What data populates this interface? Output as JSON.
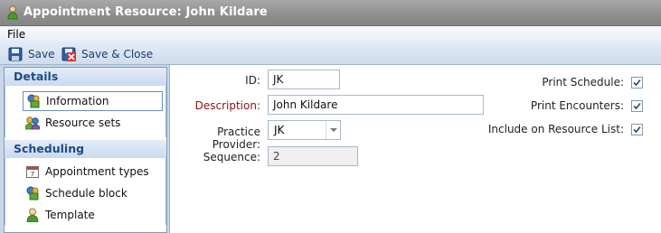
{
  "window": {
    "title": "Appointment Resource: John Kildare"
  },
  "menu": {
    "file_label": "File"
  },
  "toolbar": {
    "save_label": "Save",
    "save_close_label": "Save & Close"
  },
  "sidebar": {
    "details_header": "Details",
    "details_items": [
      "Information",
      "Resource sets"
    ],
    "scheduling_header": "Scheduling",
    "scheduling_items": [
      "Appointment types",
      "Schedule block",
      "Template"
    ]
  },
  "form": {
    "id_label": "ID:",
    "id_value": "JK",
    "description_label": "Description:",
    "description_value": "John Kildare",
    "provider_label": "Practice Provider:",
    "provider_value": "JK",
    "sequence_label": "Sequence:",
    "sequence_value": "2",
    "print_schedule_label": "Print Schedule:",
    "print_schedule_checked": true,
    "print_encounters_label": "Print Encounters:",
    "print_encounters_checked": true,
    "include_resource_label": "Include on Resource List:",
    "include_resource_checked": true
  }
}
